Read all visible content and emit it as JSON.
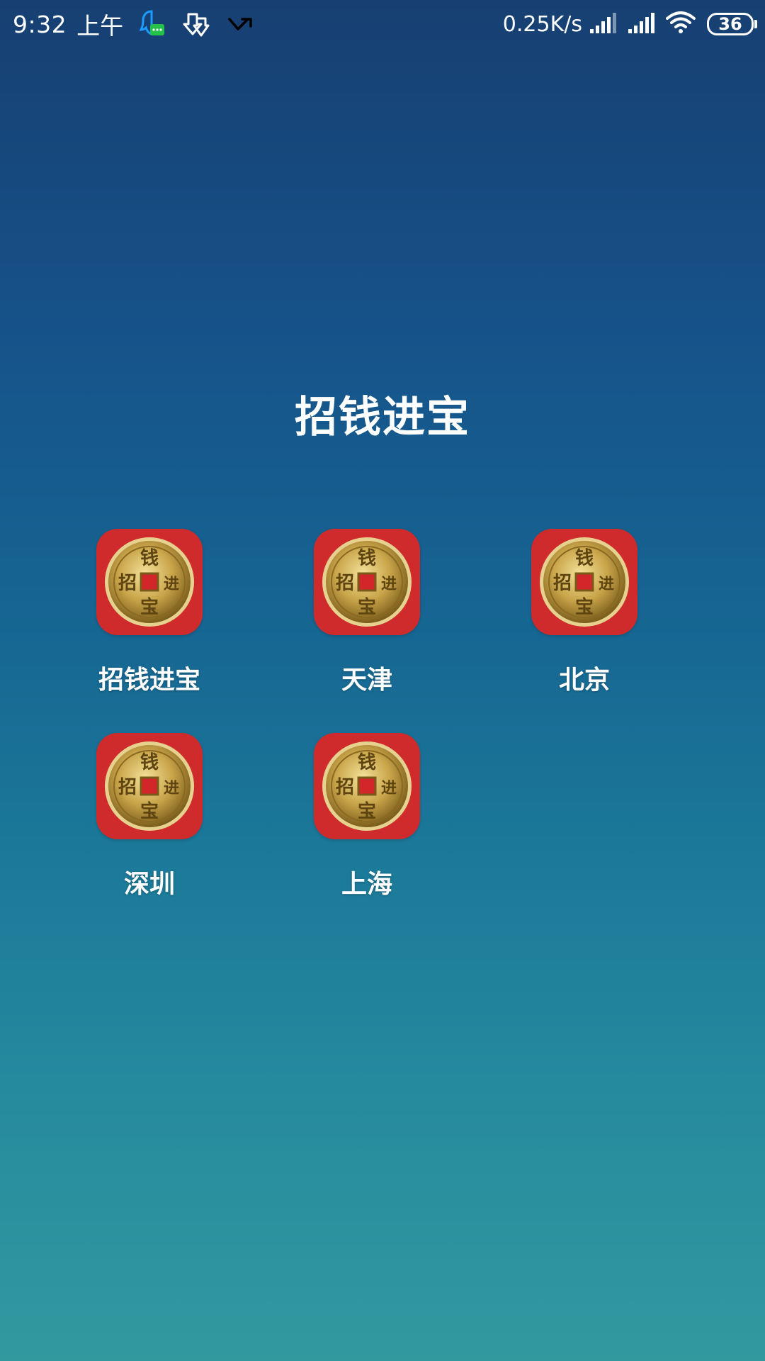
{
  "status_bar": {
    "time": "9:32",
    "ampm": "上午",
    "net_speed": "0.25K/s",
    "battery": "36",
    "icons": [
      "qq-notification-icon",
      "download-icon",
      "missed-call-icon",
      "signal-icon",
      "signal-icon",
      "wifi-icon",
      "battery-icon"
    ]
  },
  "folder": {
    "title": "招钱进宝",
    "apps": [
      {
        "label": "招钱进宝",
        "icon": "coin-app-icon"
      },
      {
        "label": "天津",
        "icon": "coin-app-icon"
      },
      {
        "label": "北京",
        "icon": "coin-app-icon"
      },
      {
        "label": "深圳",
        "icon": "coin-app-icon"
      },
      {
        "label": "上海",
        "icon": "coin-app-icon"
      }
    ]
  },
  "coin_glyphs": {
    "top": "钱",
    "left": "招",
    "right": "进",
    "bottom": "宝"
  },
  "colors": {
    "icon_bg": "#cf2a2c",
    "coin_gold": "#c9a54a"
  }
}
